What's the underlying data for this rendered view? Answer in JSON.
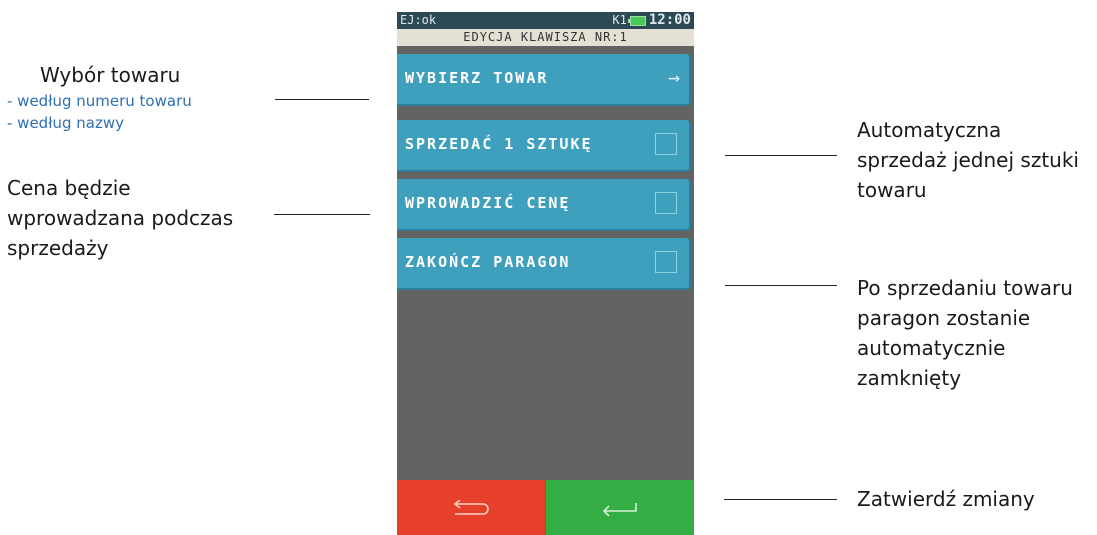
{
  "device": {
    "status_left": "EJ:ok",
    "status_indicator": "K1",
    "status_time": "12:00",
    "title": "EDYCJA KLAWISZA NR:1",
    "menu": [
      {
        "label": "WYBIERZ TOWAR",
        "control": "arrow-right-icon"
      },
      {
        "label": "SPRZEDAĆ 1 SZTUKĘ",
        "control": "checkbox"
      },
      {
        "label": "WPROWADZIĆ CENĘ",
        "control": "checkbox"
      },
      {
        "label": "ZAKOŃCZ PARAGON",
        "control": "checkbox"
      }
    ],
    "buttons": {
      "back_icon": "return-arrow-icon",
      "confirm_icon": "enter-arrow-icon",
      "back_color": "#e6402b",
      "confirm_color": "#35ad45"
    },
    "accent_color": "#3fa0be"
  },
  "annotations": {
    "select_product": {
      "title": "Wybór towaru",
      "options": [
        "- według numeru towaru",
        "- według nazwy"
      ]
    },
    "price_entry": {
      "lines": [
        "Cena będzie",
        "wprowadzana podczas",
        "sprzedaży"
      ]
    },
    "auto_sell_one": {
      "lines": [
        "Automatyczna",
        "sprzedaż jednej sztuki",
        "towaru"
      ]
    },
    "auto_close": {
      "lines": [
        "Po sprzedaniu towaru",
        "paragon zostanie",
        "automatycznie",
        "zamknięty"
      ]
    },
    "confirm": {
      "text": "Zatwierdź zmiany"
    }
  }
}
